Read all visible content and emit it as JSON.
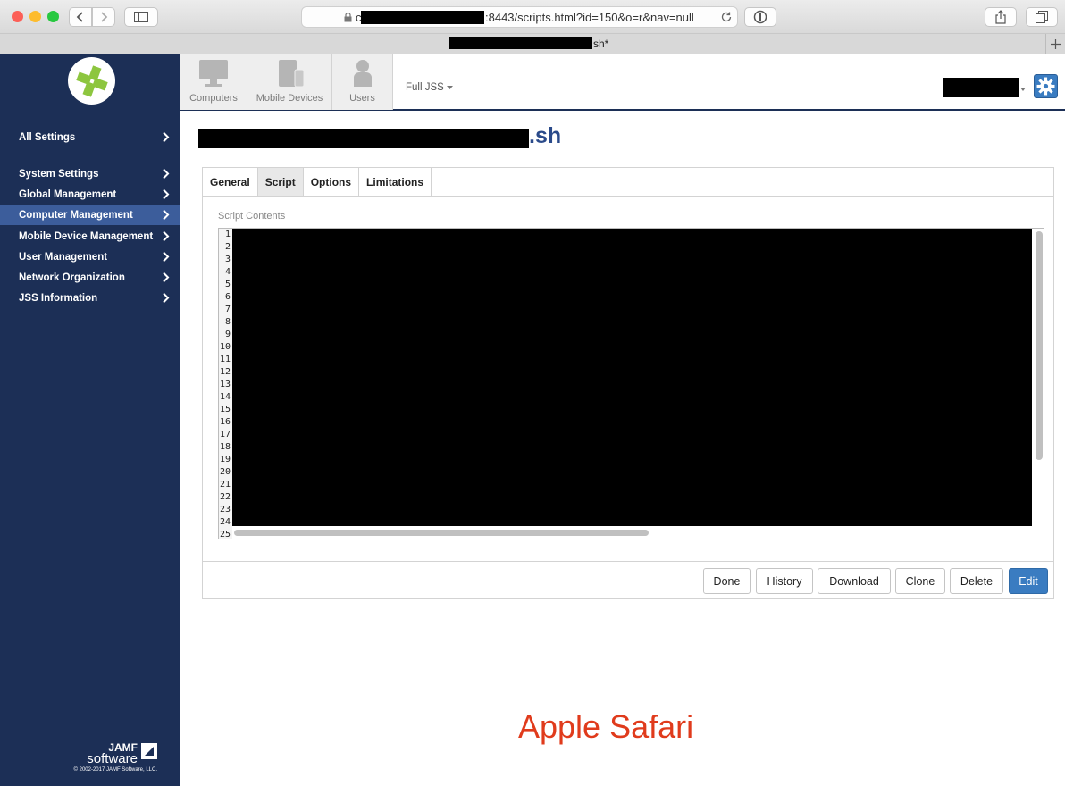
{
  "browser": {
    "url_visible_suffix": ":8443/scripts.html?id=150&o=r&nav=null",
    "url_prefix_visible": "c",
    "tab_title_suffix": "sh*",
    "traffic_lights": [
      "#fc5f57",
      "#fdbc2e",
      "#28c840"
    ]
  },
  "sidebar": {
    "all_settings": "All Settings",
    "items": [
      {
        "label": "System Settings"
      },
      {
        "label": "Global Management"
      },
      {
        "label": "Computer Management",
        "active": true
      },
      {
        "label": "Mobile Device Management"
      },
      {
        "label": "User Management"
      },
      {
        "label": "Network Organization"
      },
      {
        "label": "JSS Information"
      }
    ],
    "footer": {
      "brand_top": "JAMF",
      "brand_bottom": "software",
      "copyright": "© 2002-2017 JAMF Software, LLC."
    }
  },
  "topnav": {
    "tiles": [
      {
        "label": "Computers",
        "icon": "computer-icon"
      },
      {
        "label": "Mobile Devices",
        "icon": "mobile-devices-icon"
      },
      {
        "label": "Users",
        "icon": "user-icon"
      }
    ],
    "site_selector": "Full JSS",
    "settings_icon": "gear-icon"
  },
  "page": {
    "title_suffix": ".sh",
    "tabs": [
      "General",
      "Script",
      "Options",
      "Limitations"
    ],
    "active_tab": "Script",
    "section_label": "Script Contents",
    "line_numbers": [
      "1",
      "2",
      "3",
      "4",
      "5",
      "6",
      "7",
      "8",
      "9",
      "10",
      "11",
      "12",
      "13",
      "14",
      "15",
      "16",
      "17",
      "18",
      "19",
      "20",
      "21",
      "22",
      "23",
      "24",
      "25"
    ],
    "buttons": {
      "done": "Done",
      "history": "History",
      "download": "Download",
      "clone": "Clone",
      "delete": "Delete",
      "edit": "Edit"
    }
  },
  "overlay_caption": "Apple Safari",
  "colors": {
    "sidebar_bg": "#1c2f56",
    "sidebar_active": "#3c5d9b",
    "title_blue": "#2a4a8a",
    "primary_button": "#3a7cc1",
    "caption": "#e03b1c",
    "logo_green": "#8dc63f"
  }
}
